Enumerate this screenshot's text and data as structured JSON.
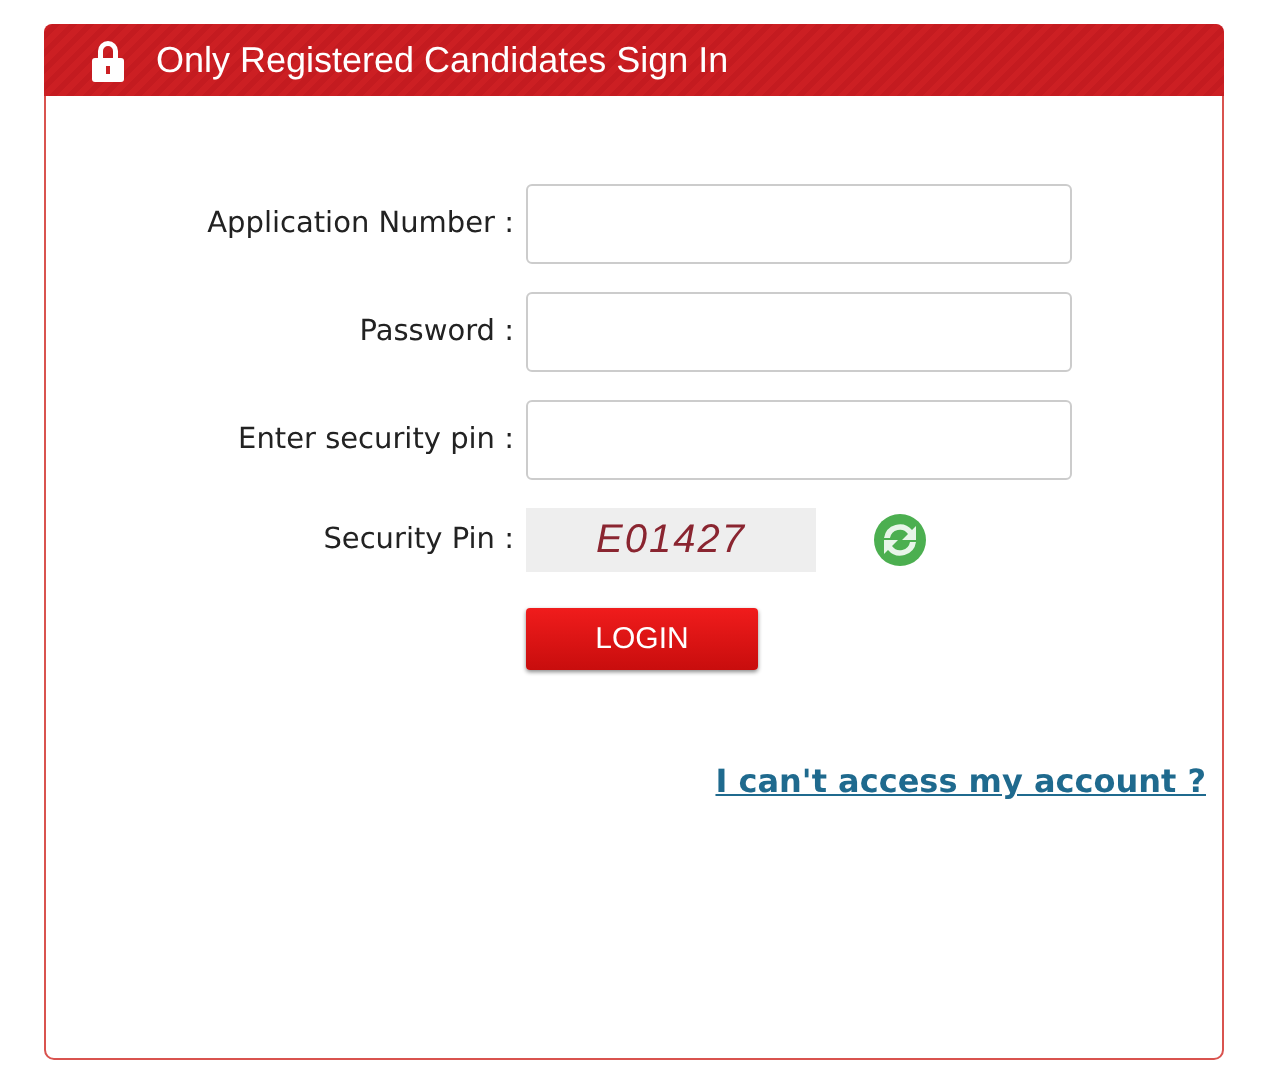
{
  "panel": {
    "title": "Only Registered Candidates Sign In"
  },
  "fields": [
    {
      "label": "Application Number :"
    },
    {
      "label": "Password :"
    },
    {
      "label": "Enter security pin :"
    }
  ],
  "captcha": {
    "label": "Security Pin :",
    "code": "E01427"
  },
  "login_button": "LOGIN",
  "help_link": "I can't access my account ?"
}
